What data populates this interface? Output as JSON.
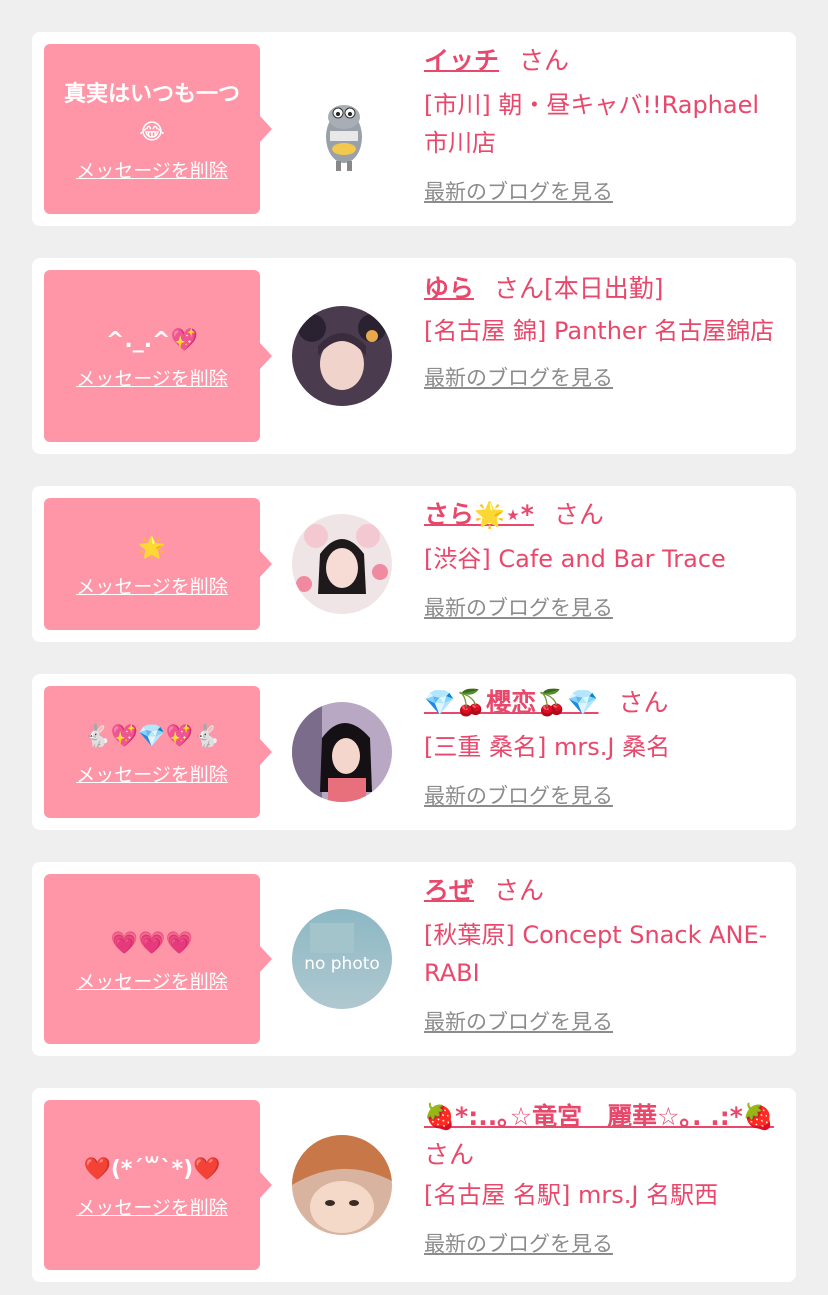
{
  "common": {
    "delete_label": "メッセージを削除",
    "blog_label": "最新のブログを見る",
    "san": "さん"
  },
  "items": [
    {
      "message": "真実はいつも一つ😂",
      "name": "イッチ",
      "suffix": "",
      "shop": "[市川] 朝・昼キャバ!!Raphael市川店"
    },
    {
      "message": "^._.^💖",
      "name": "ゆら",
      "suffix": "[本日出勤]",
      "shop": "[名古屋 錦] Panther 名古屋錦店"
    },
    {
      "message": "🌟",
      "name": "さら🌟⋆*",
      "suffix": "",
      "shop": "[渋谷] Cafe and Bar Trace"
    },
    {
      "message": "🐇💖💎💖🐇",
      "name": "💎🍒櫻恋🍒💎",
      "suffix": "",
      "shop": "[三重 桑名] mrs.J 桑名"
    },
    {
      "message": "💗💗💗",
      "name": "ろぜ",
      "suffix": "",
      "shop": "[秋葉原] Concept Snack ANE-RABI"
    },
    {
      "message": "❤️(*´꒳`*)❤️",
      "name": "🍓*:..｡☆竜宮　麗華☆｡. .:*🍓",
      "suffix": "",
      "shop": "[名古屋 名駅] mrs.J 名駅西"
    }
  ],
  "colors": {
    "accent": "#e8486b",
    "bubble": "#ff96a8",
    "link_gray": "#8c8c8c",
    "bg": "#efefef"
  }
}
